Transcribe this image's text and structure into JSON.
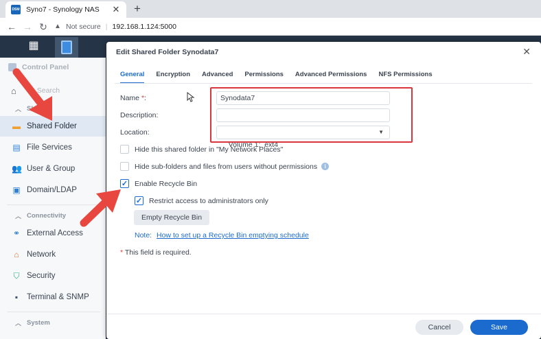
{
  "browser": {
    "tab_title": "Syno7 - Synology NAS",
    "favicon_text": "DSM",
    "not_secure": "Not secure",
    "url": "192.168.1.124:5000"
  },
  "sidebar": {
    "header": "Control Panel",
    "search_placeholder": "Search",
    "sections": {
      "sharing": "Sharing",
      "connectivity": "Connectivity",
      "system": "System"
    },
    "items": [
      {
        "label": "Shared Folder",
        "icon": "folder-icon"
      },
      {
        "label": "File Services",
        "icon": "file-services-icon"
      },
      {
        "label": "User & Group",
        "icon": "user-group-icon"
      },
      {
        "label": "Domain/LDAP",
        "icon": "domain-icon"
      },
      {
        "label": "External Access",
        "icon": "external-access-icon"
      },
      {
        "label": "Network",
        "icon": "network-icon"
      },
      {
        "label": "Security",
        "icon": "shield-icon"
      },
      {
        "label": "Terminal & SNMP",
        "icon": "terminal-icon"
      }
    ]
  },
  "dialog": {
    "title": "Edit Shared Folder Synodata7",
    "tabs": [
      "General",
      "Encryption",
      "Advanced",
      "Permissions",
      "Advanced Permissions",
      "NFS Permissions"
    ],
    "name_label": "Name",
    "name_suffix": ":",
    "name_value": "Synodata7",
    "description_label": "Description:",
    "description_value": "",
    "location_label": "Location:",
    "location_value": "Volume 1:  ext4",
    "hide_folder": "Hide this shared folder in \"My Network Places\"",
    "hide_subfolders": "Hide sub-folders and files from users without permissions",
    "enable_recycle": "Enable Recycle Bin",
    "restrict_access": "Restrict access to administrators only",
    "empty_recycle_button": "Empty Recycle Bin",
    "note_label": "Note:",
    "note_link": "How to set up a Recycle Bin emptying schedule",
    "required_note": "This field is required.",
    "cancel": "Cancel",
    "save": "Save"
  },
  "colors": {
    "accent": "#1b6bcf",
    "annotation_red": "#e8473f"
  }
}
